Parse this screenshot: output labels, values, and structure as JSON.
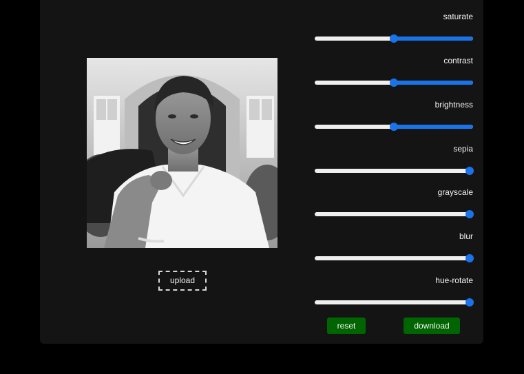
{
  "upload": {
    "label": "upload"
  },
  "sliders": [
    {
      "label": "saturate",
      "value": 0.5
    },
    {
      "label": "contrast",
      "value": 0.5
    },
    {
      "label": "brightness",
      "value": 0.5
    },
    {
      "label": "sepia",
      "value": 1.0
    },
    {
      "label": "grayscale",
      "value": 1.0
    },
    {
      "label": "blur",
      "value": 1.0
    },
    {
      "label": "hue-rotate",
      "value": 1.0
    }
  ],
  "buttons": {
    "reset": "reset",
    "download": "download"
  },
  "colors": {
    "accent": "#1a73e8",
    "button": "#006400",
    "panel": "#141414"
  }
}
